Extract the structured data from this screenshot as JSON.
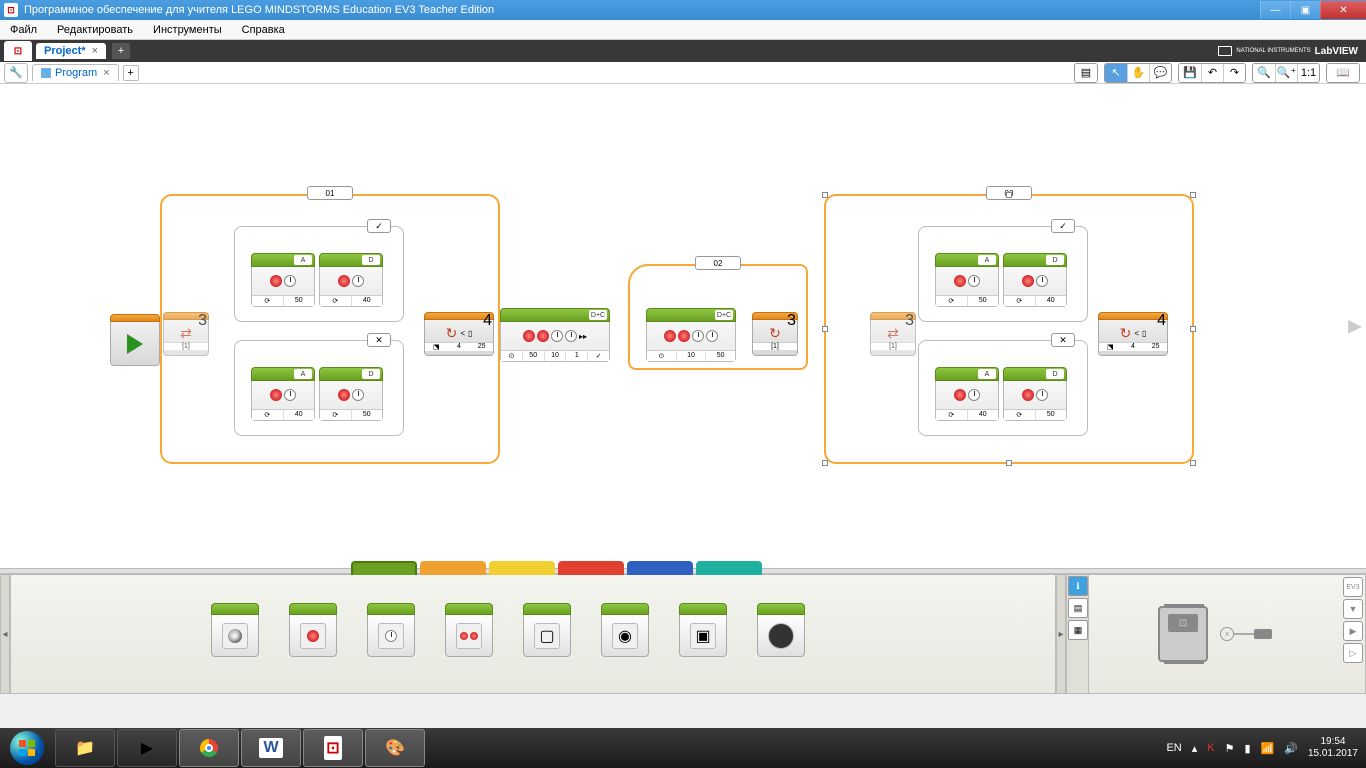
{
  "window": {
    "title": "Программное обеспечение для учителя LEGO MINDSTORMS Education EV3 Teacher Edition"
  },
  "menu": {
    "file": "Файл",
    "edit": "Редактировать",
    "tools": "Инструменты",
    "help": "Справка"
  },
  "project_tab": {
    "name": "Project*",
    "labview": "LabVIEW",
    "ni_prefix": "NATIONAL INSTRUMENTS"
  },
  "program_tab": {
    "name": "Program"
  },
  "toolbar": {
    "zoom_fit": "1:1"
  },
  "hwpanel": {
    "ev3_label": "EV3"
  },
  "canvas": {
    "switch1": {
      "label": "01",
      "count": "3",
      "true_case": {
        "mark": "✓",
        "motorA": {
          "port": "A",
          "power": "50"
        },
        "motorD": {
          "port": "D",
          "power": "40"
        }
      },
      "false_case": {
        "mark": "✕",
        "motorA": {
          "port": "A",
          "power": "40"
        },
        "motorD": {
          "port": "D",
          "power": "50"
        }
      },
      "end": {
        "count": "4",
        "cmp": "<",
        "p1": "4",
        "p2": "25"
      }
    },
    "loop2": {
      "label": "02",
      "count": "3",
      "tank1": {
        "ports": "D+C",
        "p1": "50",
        "p2": "10",
        "p3": "1",
        "chk": "✓"
      },
      "tank2": {
        "ports": "D+C",
        "p1": "10",
        "p2": "50"
      }
    },
    "switch3": {
      "label": "03",
      "count": "3",
      "true_case": {
        "mark": "✓",
        "motorA": {
          "port": "A",
          "power": "50"
        },
        "motorD": {
          "port": "D",
          "power": "40"
        }
      },
      "false_case": {
        "mark": "✕",
        "motorA": {
          "port": "A",
          "power": "40"
        },
        "motorD": {
          "port": "D",
          "power": "50"
        }
      },
      "end": {
        "count": "4",
        "cmp": "<",
        "p1": "4",
        "p2": "25"
      }
    },
    "mid_switch_end": "[1]",
    "mid_switch_end2": "[1]"
  },
  "palette": {
    "blocks": [
      "medium-motor",
      "large-motor",
      "move-steering",
      "move-tank",
      "display",
      "sound",
      "brick-light",
      "brick-button"
    ]
  },
  "tray": {
    "lang": "EN",
    "time": "19:54",
    "date": "15.01.2017"
  },
  "glyphs": {
    "brick": "⊡",
    "usb_x": "×"
  }
}
